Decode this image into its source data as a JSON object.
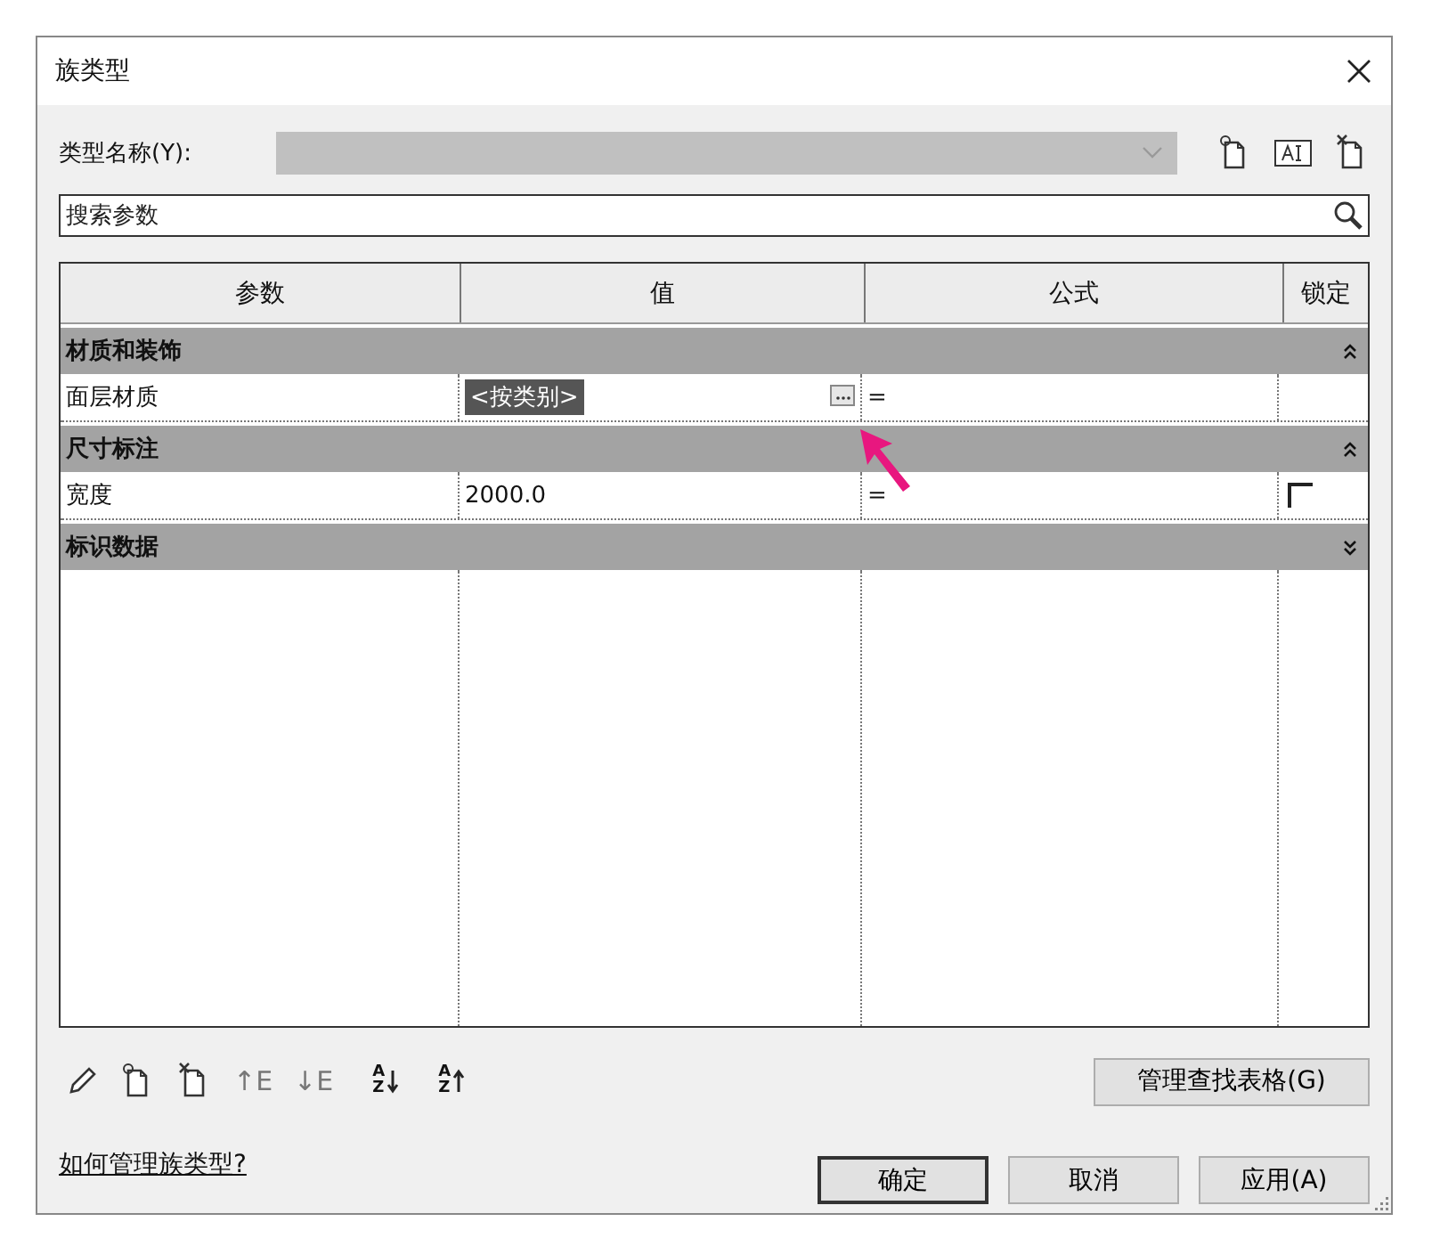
{
  "window": {
    "title": "族类型"
  },
  "type_name": {
    "label": "类型名称(Y):"
  },
  "search": {
    "placeholder": "搜索参数"
  },
  "table": {
    "columns": [
      "参数",
      "值",
      "公式",
      "锁定"
    ],
    "rows": [
      {
        "kind": "group",
        "label": "材质和装饰",
        "expanded": true
      },
      {
        "kind": "param",
        "name": "面层材质",
        "value": "<按类别>",
        "highlighted": true,
        "formula": "="
      },
      {
        "kind": "group",
        "label": "尺寸标注",
        "expanded": true
      },
      {
        "kind": "param",
        "name": "宽度",
        "value": "2000.0",
        "highlighted": false,
        "formula": "=",
        "lock": {
          "checked": false
        }
      },
      {
        "kind": "group",
        "label": "标识数据",
        "expanded": false
      }
    ]
  },
  "tools": [
    {
      "kind": "pencil"
    },
    {
      "kind": "new"
    },
    {
      "kind": "delete"
    },
    {
      "kind": "glyph",
      "text": "↑E"
    },
    {
      "kind": "glyph",
      "text": "↓E"
    },
    {
      "kind": "sort",
      "letters": [
        "A",
        "Z"
      ],
      "up": false
    },
    {
      "kind": "sort",
      "letters": [
        "A",
        "Z"
      ],
      "up": true
    }
  ],
  "lookup_button": "管理查找表格(G)",
  "help_link": "如何管理族类型?",
  "buttons": [
    {
      "label": "确定",
      "default": true
    },
    {
      "label": "取消",
      "default": false
    },
    {
      "label": "应用(A)",
      "default": false
    }
  ]
}
